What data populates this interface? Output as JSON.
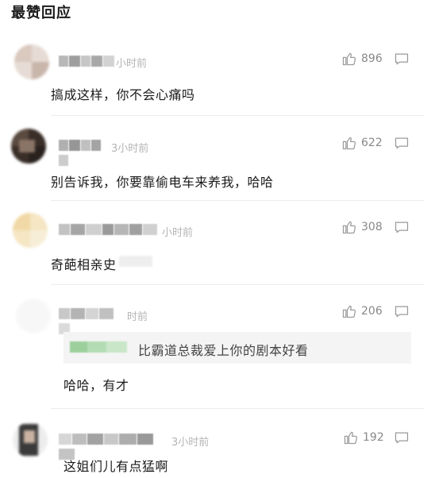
{
  "section": {
    "title": "最赞回应"
  },
  "comments": [
    {
      "time": "小时前",
      "likes": "896",
      "text": "搞成这样，你不会心痛吗"
    },
    {
      "time": "3小时前",
      "likes": "622",
      "text": "别告诉我，你要靠偷电车来养我，哈哈"
    },
    {
      "time": "小时前",
      "likes": "308",
      "text": "奇葩相亲史"
    },
    {
      "time": "时前",
      "likes": "206",
      "quote": "比霸道总裁爱上你的剧本好看",
      "text": "哈哈，有才"
    },
    {
      "time": "3小时前",
      "likes": "192",
      "text": "这姐们儿有点猛啊"
    }
  ],
  "icons": {
    "like": "thumbs-up-icon",
    "reply": "comment-bubble-icon"
  },
  "colors": {
    "meta": "#b4b4b4",
    "icon": "#9a9a9a",
    "divider": "#ececec",
    "quote_bg": "#f4f4f4"
  }
}
